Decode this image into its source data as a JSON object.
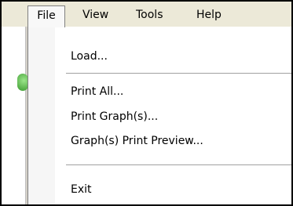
{
  "menubar": {
    "items": [
      {
        "label": "File"
      },
      {
        "label": "View"
      },
      {
        "label": "Tools"
      },
      {
        "label": "Help"
      }
    ]
  },
  "file_menu": {
    "items": [
      {
        "label": "Load..."
      },
      {
        "label": "Print All..."
      },
      {
        "label": "Print Graph(s)..."
      },
      {
        "label": "Graph(s) Print Preview..."
      },
      {
        "label": "Exit"
      }
    ]
  },
  "colors": {
    "menubar_bg": "#ece9d8",
    "dropdown_bg": "#ffffff",
    "status_icon": "#3b9a2f"
  },
  "icons": {
    "background_status": "green-status-icon"
  }
}
